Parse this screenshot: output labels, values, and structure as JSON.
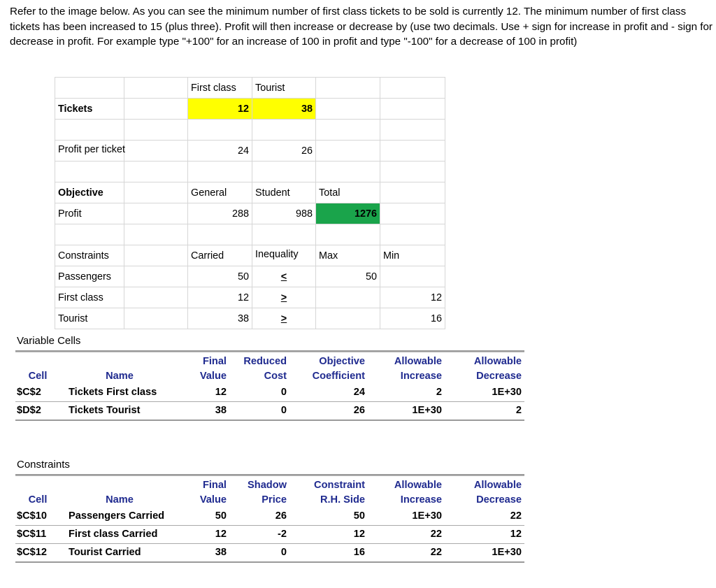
{
  "prompt": {
    "text": "Refer to the image below. As you can see the minimum number of first class tickets to be sold is currently 12. The minimum number of first class tickets has been increased to 15 (plus three). Profit will then increase or decrease by (use two decimals. Use + sign for increase in profit and - sign for decrease in profit. For example type \"+100\" for an increase of 100 in profit and type \"-100\" for a decrease of 100 in profit)"
  },
  "colors": {
    "highlight_input": "#FFFF00",
    "highlight_objective": "#1AA44B",
    "report_header_text": "#1F2A8F",
    "grid_line": "#D6D6D6"
  },
  "sheet": {
    "row1": {
      "a": "",
      "b": "",
      "c": "First class",
      "d": "Tourist",
      "e": "",
      "f": ""
    },
    "row2": {
      "a": "Tickets",
      "b": "",
      "c": "12",
      "d": "38",
      "e": "",
      "f": ""
    },
    "row3": {
      "a": "",
      "b": "",
      "c": "",
      "d": "",
      "e": "",
      "f": ""
    },
    "row4": {
      "a": "Profit per ticket",
      "b": "",
      "c": "24",
      "d": "26",
      "e": "",
      "f": ""
    },
    "row5": {
      "a": "",
      "b": "",
      "c": "",
      "d": "",
      "e": "",
      "f": ""
    },
    "row6": {
      "a": "Objective",
      "b": "",
      "c": "General",
      "d": "Student",
      "e": "Total",
      "f": ""
    },
    "row7": {
      "a": "Profit",
      "b": "",
      "c": "288",
      "d": "988",
      "e": "1276",
      "f": ""
    },
    "row8": {
      "a": "",
      "b": "",
      "c": "",
      "d": "",
      "e": "",
      "f": ""
    },
    "row9": {
      "a": "Constraints",
      "b": "",
      "c": "Carried",
      "d": "Inequality",
      "e": "Max",
      "f": "Min"
    },
    "row10": {
      "a": "Passengers",
      "b": "",
      "c": "50",
      "d": "<",
      "e": "50",
      "f": ""
    },
    "row11": {
      "a": "First class",
      "b": "",
      "c": "12",
      "d": ">",
      "e": "",
      "f": "12"
    },
    "row12": {
      "a": "Tourist",
      "b": "",
      "c": "38",
      "d": ">",
      "e": "",
      "f": "16"
    }
  },
  "variable_cells": {
    "title": "Variable Cells",
    "headers_top": [
      "",
      "",
      "Final",
      "Reduced",
      "Objective",
      "Allowable",
      "Allowable"
    ],
    "headers_bottom": [
      "Cell",
      "Name",
      "Value",
      "Cost",
      "Coefficient",
      "Increase",
      "Decrease"
    ],
    "rows": [
      {
        "cell": "$C$2",
        "name": "Tickets First class",
        "final_value": "12",
        "reduced_cost": "0",
        "objective_coefficient": "24",
        "allowable_increase": "2",
        "allowable_decrease": "1E+30"
      },
      {
        "cell": "$D$2",
        "name": "Tickets Tourist",
        "final_value": "38",
        "reduced_cost": "0",
        "objective_coefficient": "26",
        "allowable_increase": "1E+30",
        "allowable_decrease": "2"
      }
    ]
  },
  "constraints": {
    "title": "Constraints",
    "headers_top": [
      "",
      "",
      "Final",
      "Shadow",
      "Constraint",
      "Allowable",
      "Allowable"
    ],
    "headers_bottom": [
      "Cell",
      "Name",
      "Value",
      "Price",
      "R.H. Side",
      "Increase",
      "Decrease"
    ],
    "rows": [
      {
        "cell": "$C$10",
        "name": "Passengers Carried",
        "final_value": "50",
        "shadow_price": "26",
        "rh_side": "50",
        "allowable_increase": "1E+30",
        "allowable_decrease": "22"
      },
      {
        "cell": "$C$11",
        "name": "First class Carried",
        "final_value": "12",
        "shadow_price": "-2",
        "rh_side": "12",
        "allowable_increase": "22",
        "allowable_decrease": "12"
      },
      {
        "cell": "$C$12",
        "name": "Tourist Carried",
        "final_value": "38",
        "shadow_price": "0",
        "rh_side": "16",
        "allowable_increase": "22",
        "allowable_decrease": "1E+30"
      }
    ]
  }
}
